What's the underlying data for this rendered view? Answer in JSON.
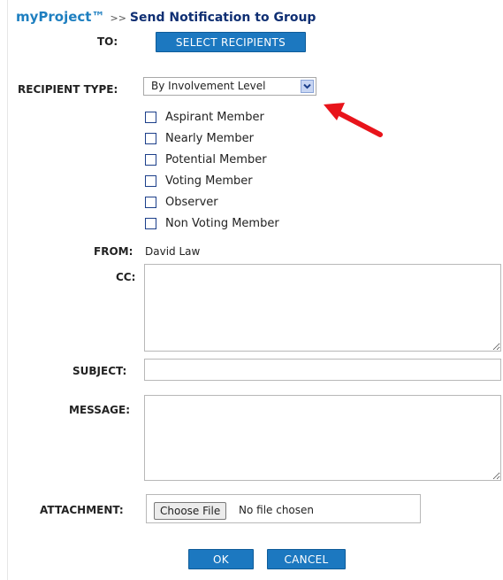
{
  "header": {
    "brand": "myProject™",
    "separator": ">>",
    "title": "Send Notification to Group"
  },
  "to": {
    "label": "TO:",
    "button_label": "SELECT RECIPIENTS"
  },
  "recipient_type": {
    "label": "RECIPIENT TYPE:",
    "selected_option": "By Involvement Level",
    "arrow_icon": "chevron-down-icon"
  },
  "involvement_levels": [
    {
      "label": "Aspirant Member",
      "checked": false
    },
    {
      "label": "Nearly Member",
      "checked": false
    },
    {
      "label": "Potential Member",
      "checked": false
    },
    {
      "label": "Voting Member",
      "checked": false
    },
    {
      "label": "Observer",
      "checked": false
    },
    {
      "label": "Non Voting Member",
      "checked": false
    }
  ],
  "from": {
    "label": "FROM:",
    "value": "David Law"
  },
  "cc": {
    "label": "CC:",
    "value": ""
  },
  "subject": {
    "label": "SUBJECT:",
    "value": ""
  },
  "message": {
    "label": "MESSAGE:",
    "value": ""
  },
  "attachment": {
    "label": "ATTACHMENT:",
    "button_label": "Choose File",
    "status": "No file chosen"
  },
  "actions": {
    "ok_label": "OK",
    "cancel_label": "CANCEL"
  },
  "colors": {
    "brand": "#1e7fc0",
    "title": "#0f2f73",
    "button": "#1c78c0",
    "annotation_arrow": "#e8141b"
  }
}
